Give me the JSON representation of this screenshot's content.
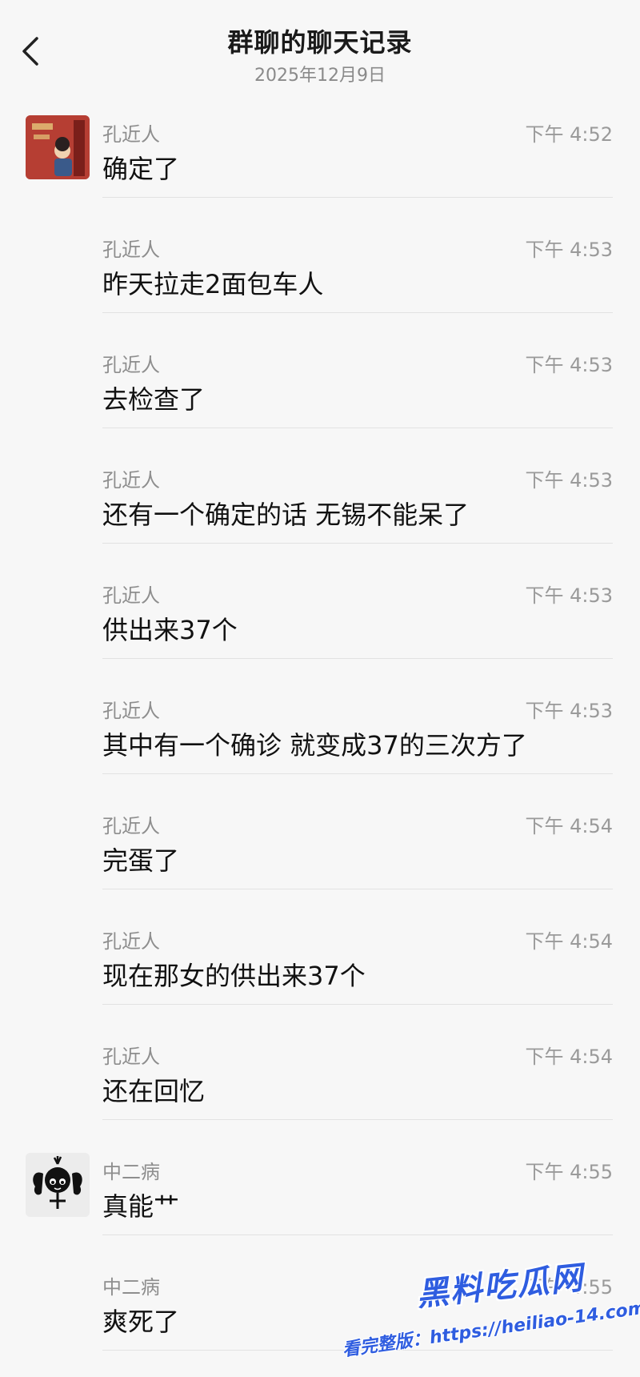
{
  "header": {
    "title": "群聊的聊天记录",
    "date": "2025年12月9日"
  },
  "messages": [
    {
      "sender": "孔近人",
      "time": "下午 4:52",
      "text": "确定了",
      "avatar": "red-poster-avatar"
    },
    {
      "sender": "孔近人",
      "time": "下午 4:53",
      "text": "昨天拉走2面包车人"
    },
    {
      "sender": "孔近人",
      "time": "下午 4:53",
      "text": "去检查了"
    },
    {
      "sender": "孔近人",
      "time": "下午 4:53",
      "text": "还有一个确定的话 无锡不能呆了"
    },
    {
      "sender": "孔近人",
      "time": "下午 4:53",
      "text": "供出来37个"
    },
    {
      "sender": "孔近人",
      "time": "下午 4:53",
      "text": "其中有一个确诊 就变成37的三次方了"
    },
    {
      "sender": "孔近人",
      "time": "下午 4:54",
      "text": "完蛋了"
    },
    {
      "sender": "孔近人",
      "time": "下午 4:54",
      "text": "现在那女的供出来37个"
    },
    {
      "sender": "孔近人",
      "time": "下午 4:54",
      "text": "还在回忆"
    },
    {
      "sender": "中二病",
      "time": "下午 4:55",
      "text": "真能艹",
      "avatar": "cartoon-girl-avatar"
    },
    {
      "sender": "中二病",
      "time": "下午 4:55",
      "text": "爽死了"
    }
  ],
  "watermark": {
    "brand": "黑料吃瓜网",
    "line": "看完整版：https://heiliao-14.com"
  },
  "colors": {
    "background": "#f7f7f7",
    "text": "#111111",
    "meta": "#8e8e8e",
    "watermark": "#2f5de0"
  }
}
